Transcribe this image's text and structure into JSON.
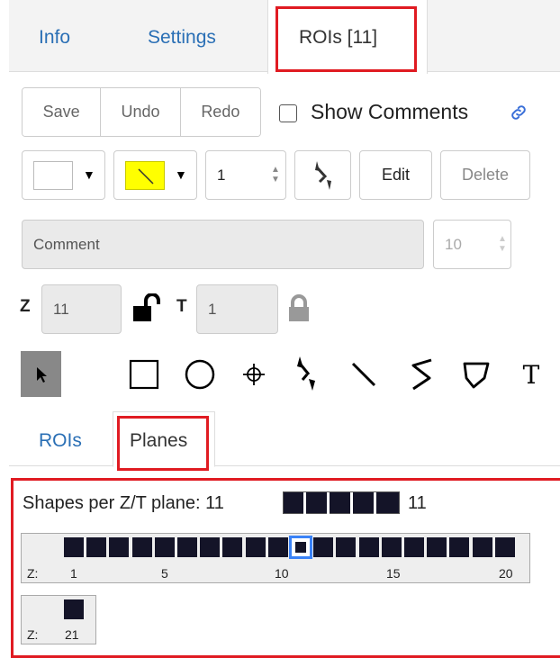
{
  "tabs": [
    {
      "label": "Info"
    },
    {
      "label": "Settings"
    },
    {
      "label": "ROIs [11]",
      "active": true
    }
  ],
  "toolbar": {
    "save": "Save",
    "undo": "Undo",
    "redo": "Redo",
    "show_comments": "Show Comments",
    "show_comments_checked": false,
    "link_icon": "link-icon"
  },
  "style_row": {
    "fill_color": "#ffffff",
    "stroke_color": "#ffff00",
    "stroke_width": "1",
    "edit": "Edit",
    "delete": "Delete"
  },
  "comment": {
    "placeholder": "Comment",
    "font_size": "10"
  },
  "zt": {
    "z_label": "Z",
    "z_value": "11",
    "z_lock": "unlocked",
    "t_label": "T",
    "t_value": "1",
    "t_lock": "locked"
  },
  "tools": [
    "select",
    "rectangle",
    "ellipse",
    "point",
    "arrow",
    "line",
    "polyline",
    "polygon",
    "text"
  ],
  "tools_text_glyph": "T",
  "subtabs": [
    {
      "label": "ROIs"
    },
    {
      "label": "Planes",
      "active": true
    }
  ],
  "planes": {
    "summary_text": "Shapes per Z/T plane: 11",
    "summary_count": "11",
    "z_prefix": "Z:",
    "ticks": [
      "1",
      "5",
      "10",
      "15",
      "20"
    ],
    "selected_z": 11,
    "row2_tick": "21"
  },
  "colors": {
    "accent_link": "#2a6fb5",
    "highlight": "#e01b22",
    "plane_square": "#141428",
    "selected_border": "#3a82f7"
  }
}
